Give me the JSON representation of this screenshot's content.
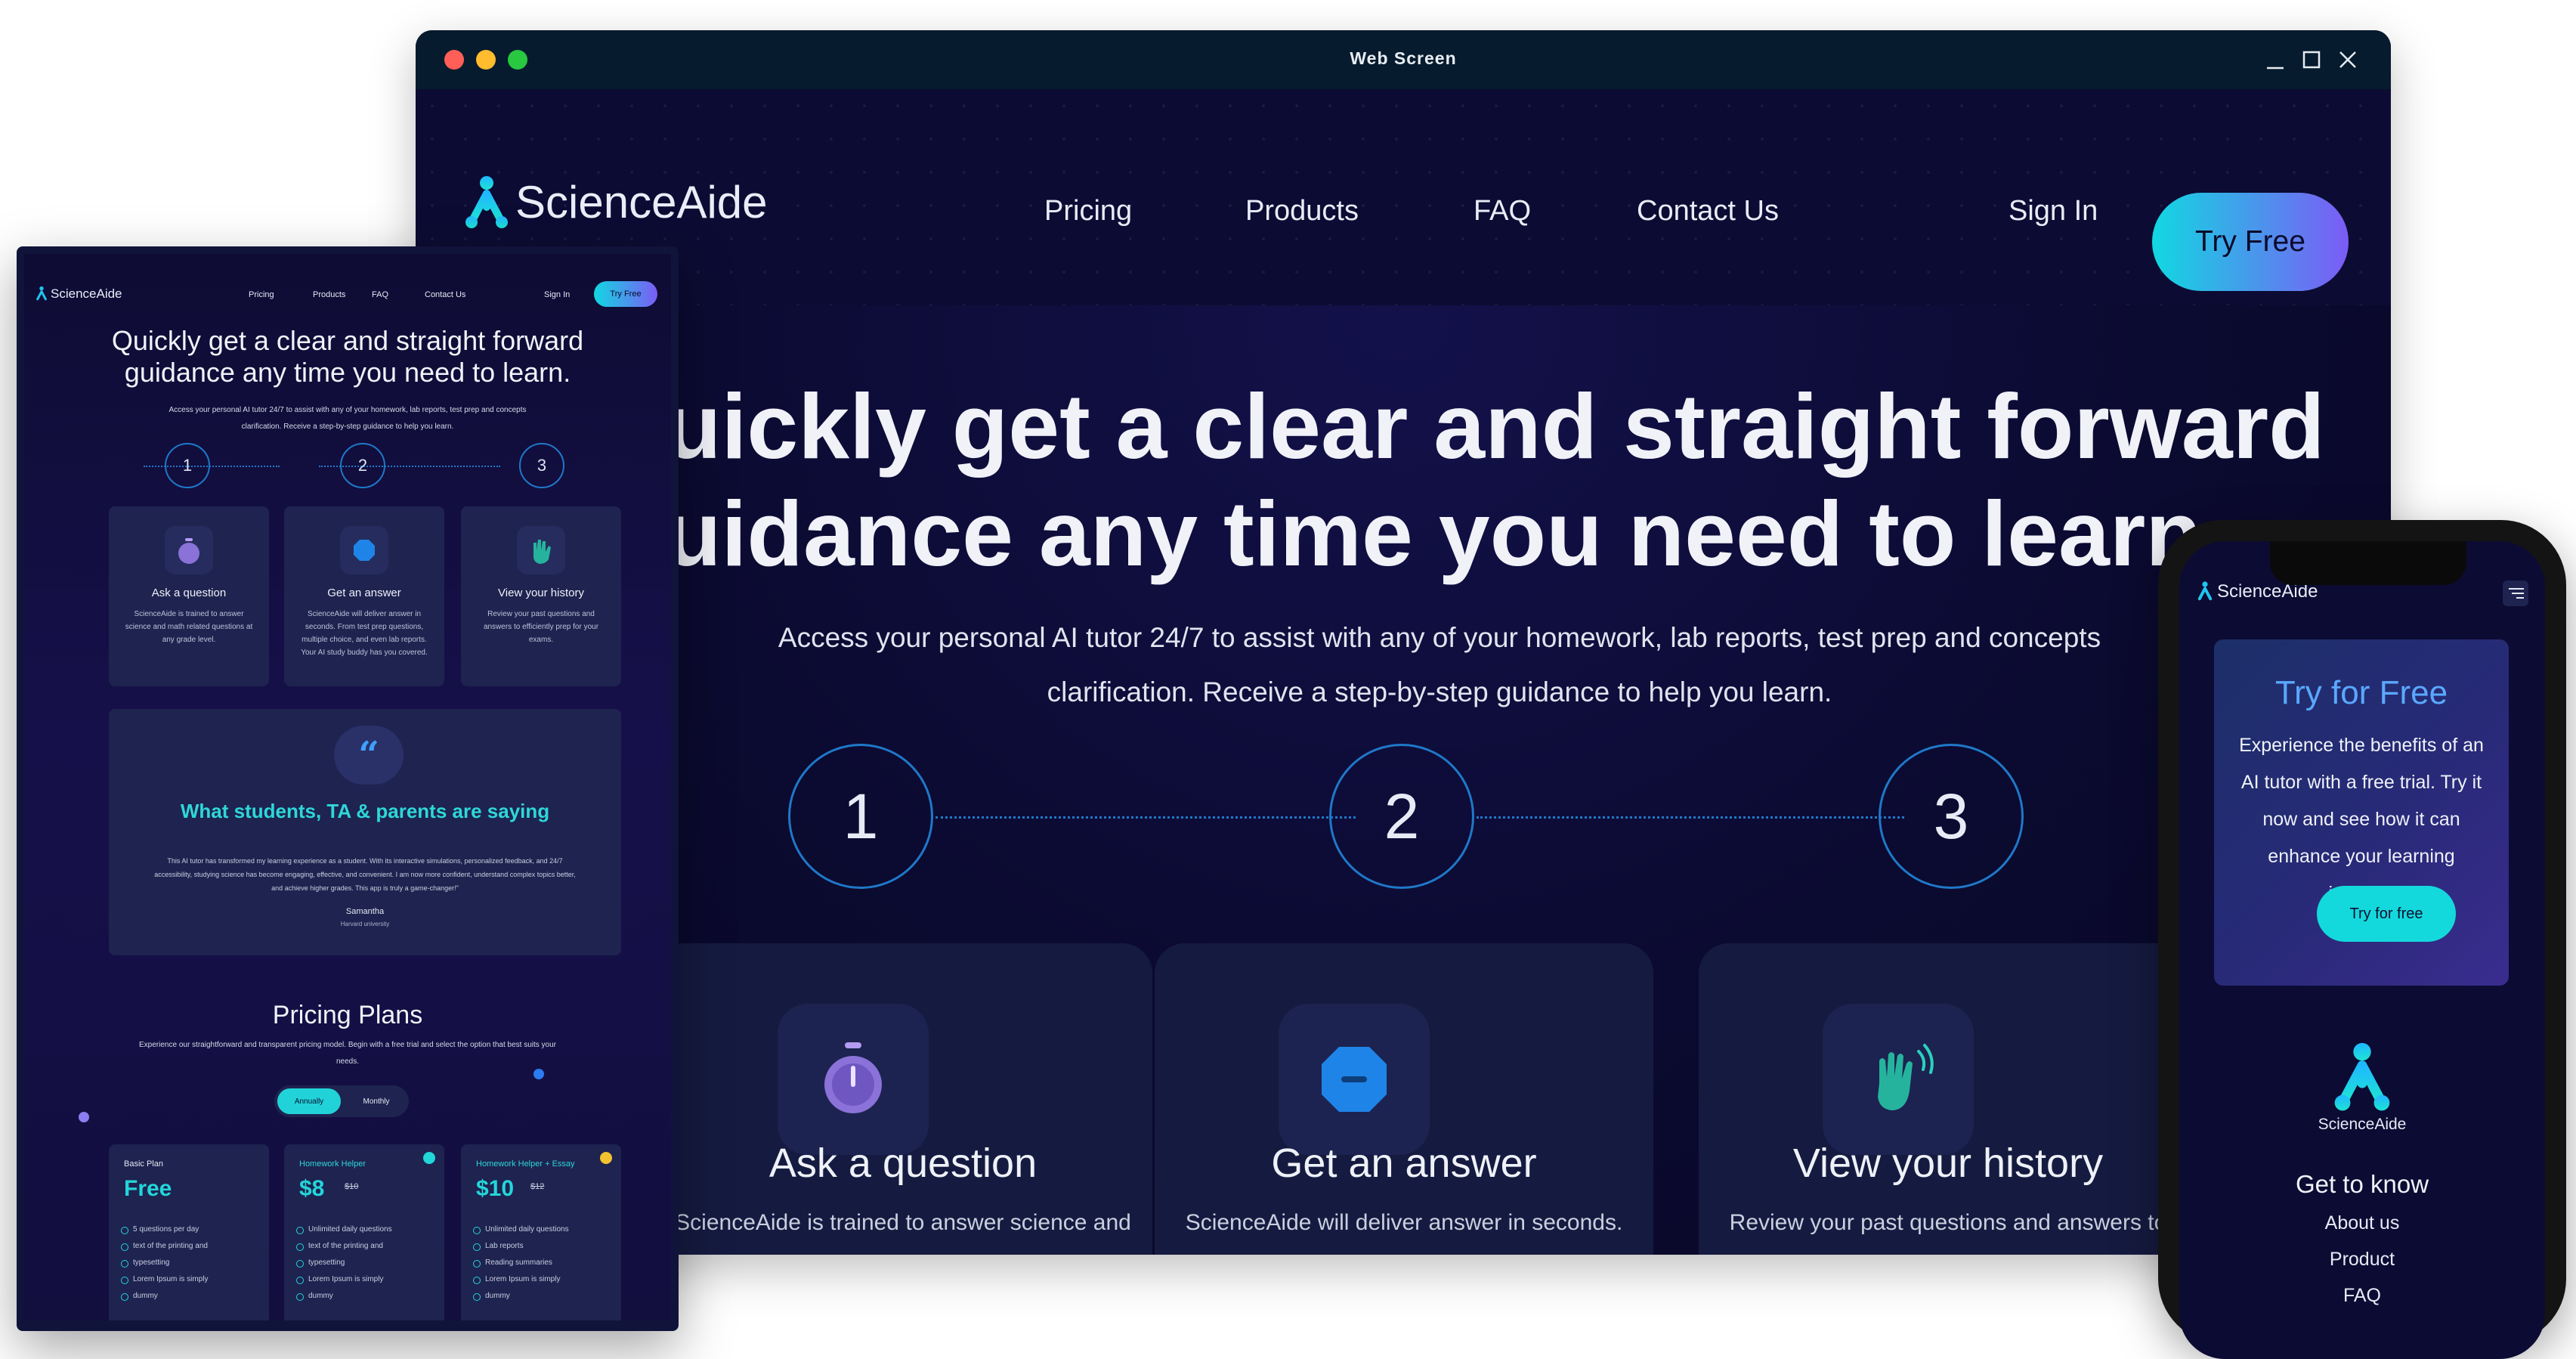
{
  "window": {
    "title": "Web Screen"
  },
  "desktop": {
    "brand": "ScienceAide",
    "nav": [
      "Pricing",
      "Products",
      "FAQ",
      "Contact Us"
    ],
    "sign_in": "Sign In",
    "try_free": "Try Free",
    "hero_line1": "uickly get a clear and straight forward",
    "hero_line2": "uidance any time you need to learn.",
    "hero_sub": "Access your personal AI tutor 24/7 to assist with any of your homework, lab reports, test prep and concepts clarification. Receive a step-by-step guidance to help you learn.",
    "steps": [
      "1",
      "2",
      "3"
    ],
    "cards": [
      {
        "title": "Ask a question",
        "desc": "ScienceAide is trained to answer science and math related"
      },
      {
        "title": "Get an answer",
        "desc": "ScienceAide will deliver answer in seconds. From test prep questions,"
      },
      {
        "title": "View your history",
        "desc": "Review your past questions and answers to efficiently prep for your"
      }
    ]
  },
  "tablet": {
    "brand": "ScienceAide",
    "nav": [
      "Pricing",
      "Products",
      "FAQ",
      "Contact Us"
    ],
    "sign_in": "Sign In",
    "try_free": "Try Free",
    "hero": "Quickly get a clear and straight forward guidance any time you need to learn.",
    "hero_sub": "Access your personal AI tutor 24/7 to assist with any of your homework, lab reports, test prep and concepts clarification. Receive a step-by-step guidance to help you learn.",
    "steps": [
      "1",
      "2",
      "3"
    ],
    "cards": [
      {
        "title": "Ask a question",
        "desc": "ScienceAide is trained to answer science and math related questions at any grade level."
      },
      {
        "title": "Get an answer",
        "desc": "ScienceAide will deliver answer in seconds. From test prep questions, multiple choice, and even lab reports. Your AI study buddy has you covered."
      },
      {
        "title": "View your history",
        "desc": "Review your past questions and answers to efficiently prep for your exams."
      }
    ],
    "testimonial_heading": "What students, TA & parents are saying",
    "testimonial_quote": "This AI tutor has transformed my learning experience as a student. With its interactive simulations, personalized feedback, and 24/7 accessibility, studying science has become engaging, effective, and convenient. I am now more confident, understand complex topics better, and achieve higher grades. This app is truly a game-changer!\"",
    "testimonial_name": "Samantha",
    "testimonial_org": "Harvard university",
    "pricing_title": "Pricing Plans",
    "pricing_sub": "Experience our straightforward and transparent pricing model. Begin with a free trial and select the option that best suits your needs.",
    "toggle": [
      "Annually",
      "Monthly"
    ],
    "plans": [
      {
        "name": "Basic Plan",
        "price": "Free",
        "old": "",
        "features": [
          "5 questions per day",
          "text of the printing and",
          "typesetting",
          "Lorem Ipsum is simply",
          "dummy"
        ]
      },
      {
        "name": "Homework Helper",
        "price": "$8",
        "old": "$10",
        "features": [
          "Unlimited daily questions",
          "text of the printing and",
          "typesetting",
          "Lorem Ipsum is simply",
          "dummy"
        ]
      },
      {
        "name": "Homework Helper + Essay",
        "price": "$10",
        "old": "$12",
        "features": [
          "Unlimited daily questions",
          "Lab reports",
          "Reading summaries",
          "Lorem Ipsum is simply",
          "dummy"
        ]
      }
    ]
  },
  "phone": {
    "brand": "ScienceAide",
    "trial_title": "Try for Free",
    "trial_text": "Experience the benefits of an AI tutor with a free trial. Try it now and see how it can enhance your learning journey.",
    "trial_button": "Try for free",
    "footer_brand": "ScienceAide",
    "footer_heading": "Get to know",
    "footer_links": [
      "About us",
      "Product",
      "FAQ"
    ]
  },
  "colors": {
    "accent_cyan": "#11d8e2",
    "accent_purple": "#7c5bf5",
    "bg_dark": "#0b0a30",
    "step_blue": "#1f78c8"
  }
}
